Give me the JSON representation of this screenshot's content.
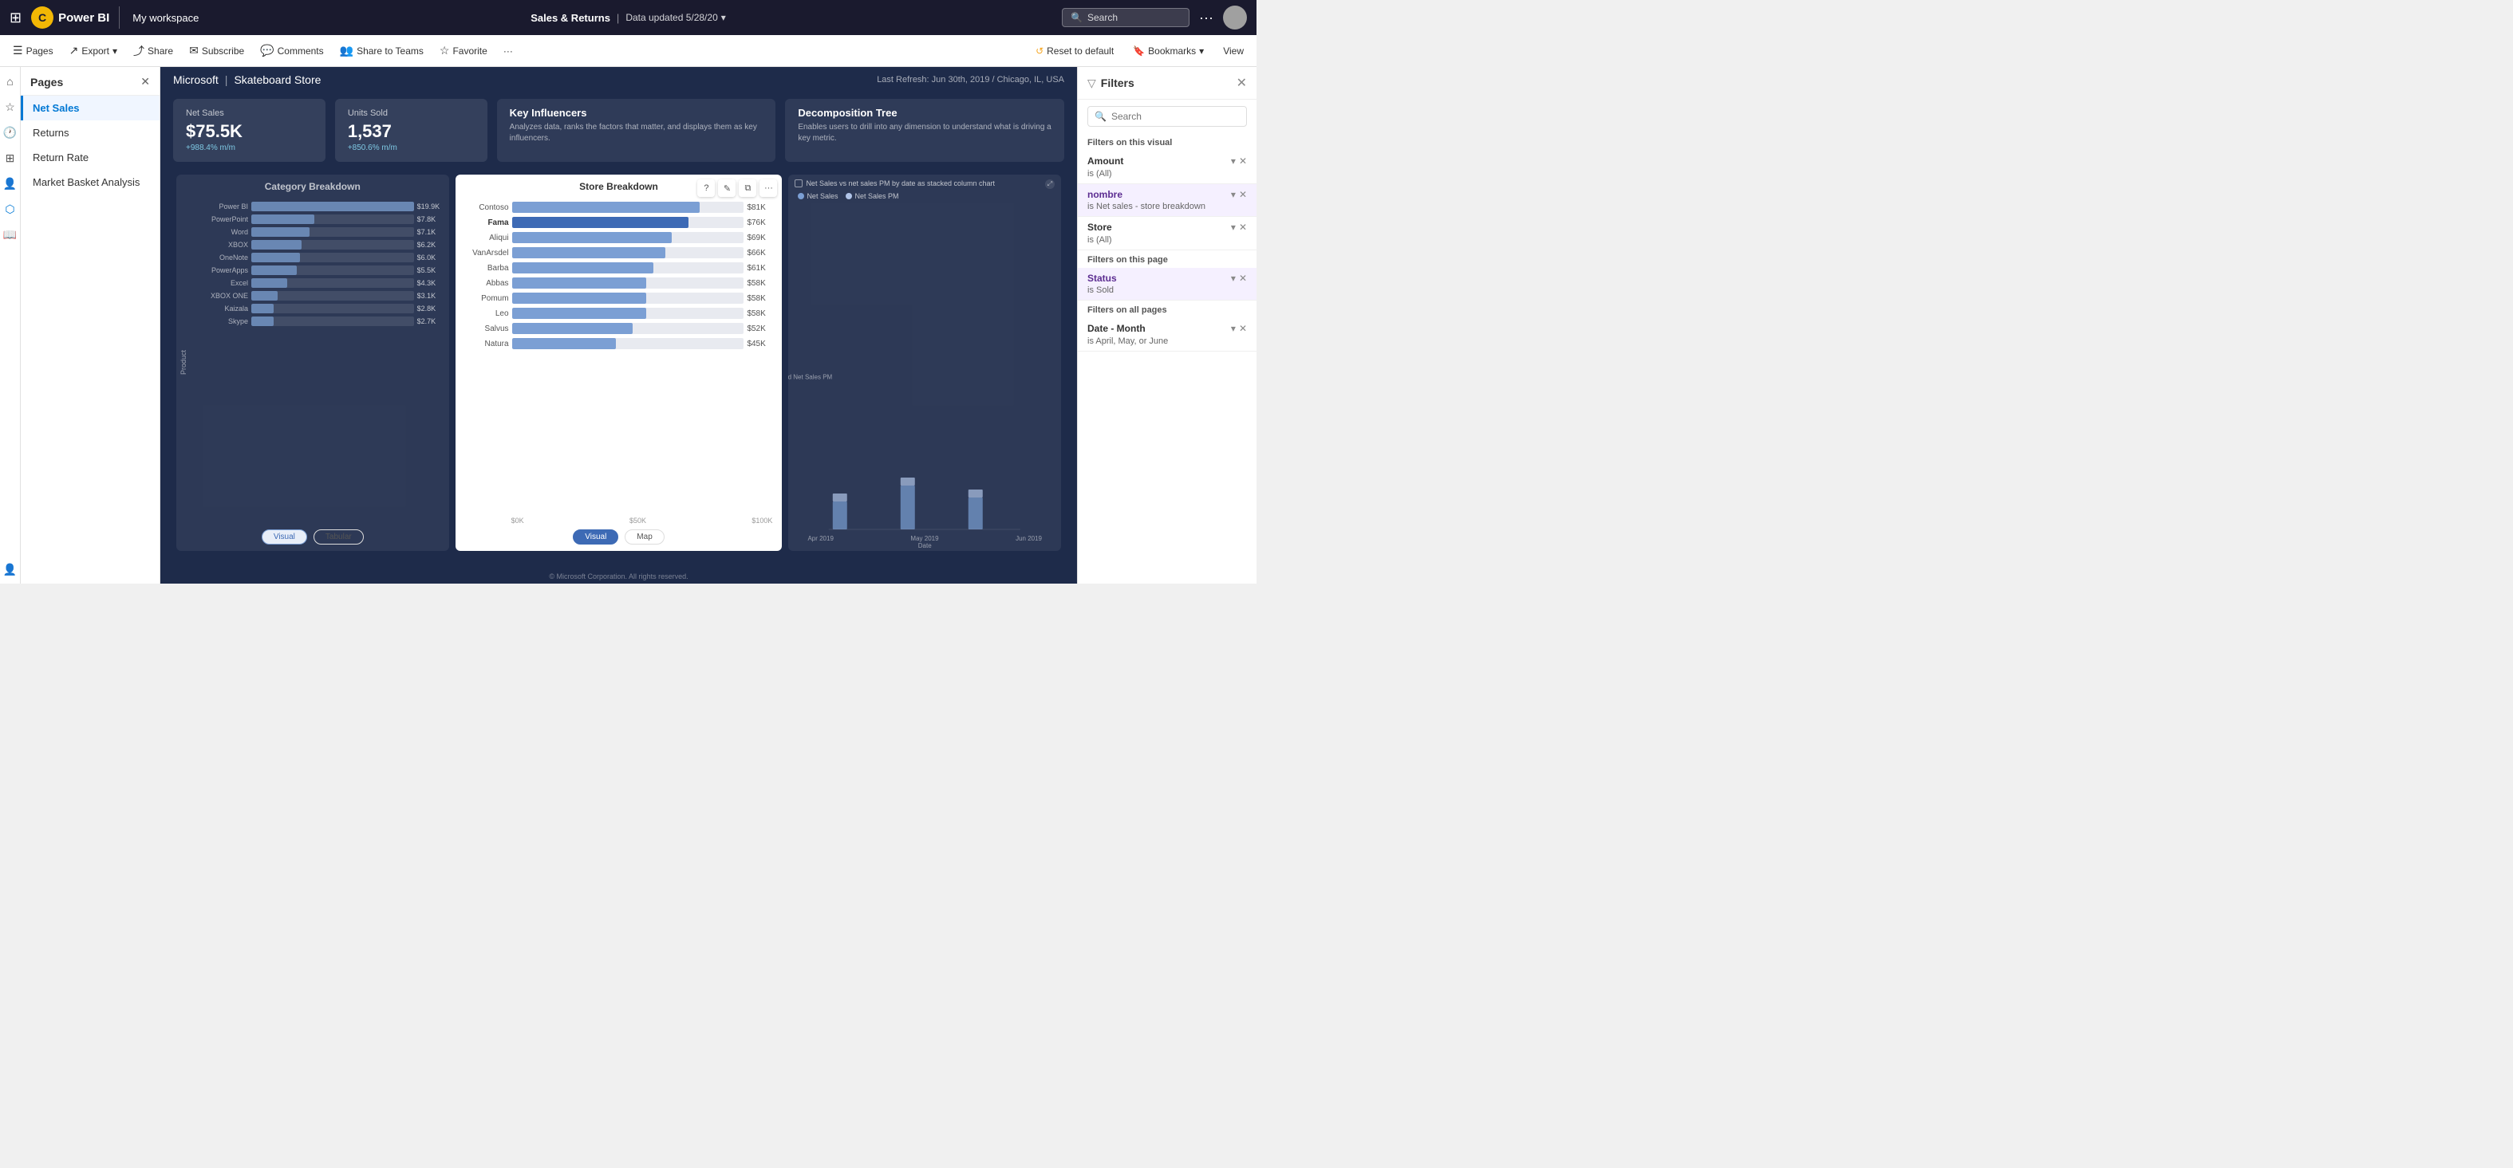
{
  "topnav": {
    "logo_text": "C",
    "brand": "Power BI",
    "workspace": "My workspace",
    "report_title": "Sales & Returns",
    "report_meta": "Data updated 5/28/20",
    "search_placeholder": "Search",
    "ellipsis": "···"
  },
  "toolbar": {
    "pages_label": "Pages",
    "export_label": "Export",
    "share_label": "Share",
    "subscribe_label": "Subscribe",
    "comments_label": "Comments",
    "share_teams_label": "Share to Teams",
    "favorite_label": "Favorite",
    "more_label": "···",
    "reset_label": "Reset to default",
    "bookmarks_label": "Bookmarks",
    "view_label": "View"
  },
  "pages_panel": {
    "title": "Pages",
    "items": [
      {
        "label": "Net Sales",
        "active": true
      },
      {
        "label": "Returns",
        "active": false
      },
      {
        "label": "Return Rate",
        "active": false
      },
      {
        "label": "Market Basket Analysis",
        "active": false
      }
    ]
  },
  "canvas": {
    "breadcrumb_org": "Microsoft",
    "breadcrumb_store": "Skateboard Store",
    "meta": "Last Refresh: Jun 30th, 2019 / Chicago, IL, USA",
    "kpis": [
      {
        "label": "Net Sales",
        "value": "$75.5K",
        "change": "+988.4% m/m"
      },
      {
        "label": "Units Sold",
        "value": "1,537",
        "change": "+850.6% m/m"
      }
    ],
    "kpi_cards": [
      {
        "title": "Key Influencers",
        "desc": "Analyzes data, ranks the factors that matter, and displays them as key influencers."
      },
      {
        "title": "Decomposition Tree",
        "desc": "Enables users to drill into any dimension to understand what is driving a key metric."
      }
    ],
    "category_chart": {
      "title": "Category Breakdown",
      "y_label": "Product",
      "bars": [
        {
          "label": "Power BI",
          "value": "$19.9K",
          "pct": 100
        },
        {
          "label": "PowerPoint",
          "value": "$7.8K",
          "pct": 39
        },
        {
          "label": "Word",
          "value": "$7.1K",
          "pct": 36
        },
        {
          "label": "XBOX",
          "value": "$6.2K",
          "pct": 31
        },
        {
          "label": "OneNote",
          "value": "$6.0K",
          "pct": 30
        },
        {
          "label": "PowerApps",
          "value": "$5.5K",
          "pct": 28
        },
        {
          "label": "Excel",
          "value": "$4.3K",
          "pct": 22
        },
        {
          "label": "XBOX ONE",
          "value": "$3.1K",
          "pct": 16
        },
        {
          "label": "Kaizala",
          "value": "$2.8K",
          "pct": 14
        },
        {
          "label": "Skype",
          "value": "$2.7K",
          "pct": 14
        }
      ],
      "tabs": [
        {
          "label": "Visual",
          "active": true
        },
        {
          "label": "Tabular",
          "active": false
        }
      ]
    },
    "store_chart": {
      "title": "Store Breakdown",
      "bars": [
        {
          "label": "Contoso",
          "value": "$81K",
          "pct": 81,
          "highlight": false
        },
        {
          "label": "Fama",
          "value": "$76K",
          "pct": 76,
          "highlight": true
        },
        {
          "label": "Aliqui",
          "value": "$69K",
          "pct": 69,
          "highlight": false
        },
        {
          "label": "VanArsdel",
          "value": "$66K",
          "pct": 66,
          "highlight": false
        },
        {
          "label": "Barba",
          "value": "$61K",
          "pct": 61,
          "highlight": false
        },
        {
          "label": "Abbas",
          "value": "$58K",
          "pct": 58,
          "highlight": false
        },
        {
          "label": "Pomum",
          "value": "$58K",
          "pct": 58,
          "highlight": false
        },
        {
          "label": "Leo",
          "value": "$58K",
          "pct": 58,
          "highlight": false
        },
        {
          "label": "Salvus",
          "value": "$52K",
          "pct": 52,
          "highlight": false
        },
        {
          "label": "Natura",
          "value": "$45K",
          "pct": 45,
          "highlight": false
        }
      ],
      "x_axis": [
        "$0K",
        "$50K",
        "$100K"
      ],
      "tabs": [
        {
          "label": "Visual",
          "active": true
        },
        {
          "label": "Map",
          "active": false
        }
      ]
    },
    "ns_chart": {
      "title": "Net Sales vs net sales PM by date as stacked column chart",
      "legend": [
        {
          "label": "Net Sales",
          "color": "#7b9fd4"
        },
        {
          "label": "Net Sales PM",
          "color": "#b0c4e8"
        }
      ],
      "checkbox_label": "Net Sales vs Net Sales PM",
      "x_labels": [
        "Apr 2019",
        "May 2019",
        "Jun 2019"
      ],
      "x_label": "Date",
      "y_label": "Net Sales and Net Sales PM"
    },
    "footer": "© Microsoft Corporation. All rights reserved."
  },
  "filters": {
    "title": "Filters",
    "search_placeholder": "Search",
    "sections": {
      "visual": {
        "label": "Filters on this visual",
        "items": [
          {
            "name": "Amount",
            "value": "is (All)",
            "highlighted": false
          },
          {
            "name": "nombre",
            "value": "is Net sales - store breakdown",
            "highlighted": true
          }
        ]
      },
      "store": {
        "name": "Store",
        "value": "is (All)",
        "highlighted": false
      },
      "page": {
        "label": "Filters on this page",
        "items": [
          {
            "name": "Status",
            "value": "is Sold",
            "highlighted": true
          }
        ]
      },
      "allpages": {
        "label": "Filters on all pages",
        "items": [
          {
            "name": "Date - Month",
            "value": "is April, May, or June",
            "highlighted": false
          }
        ]
      }
    }
  }
}
